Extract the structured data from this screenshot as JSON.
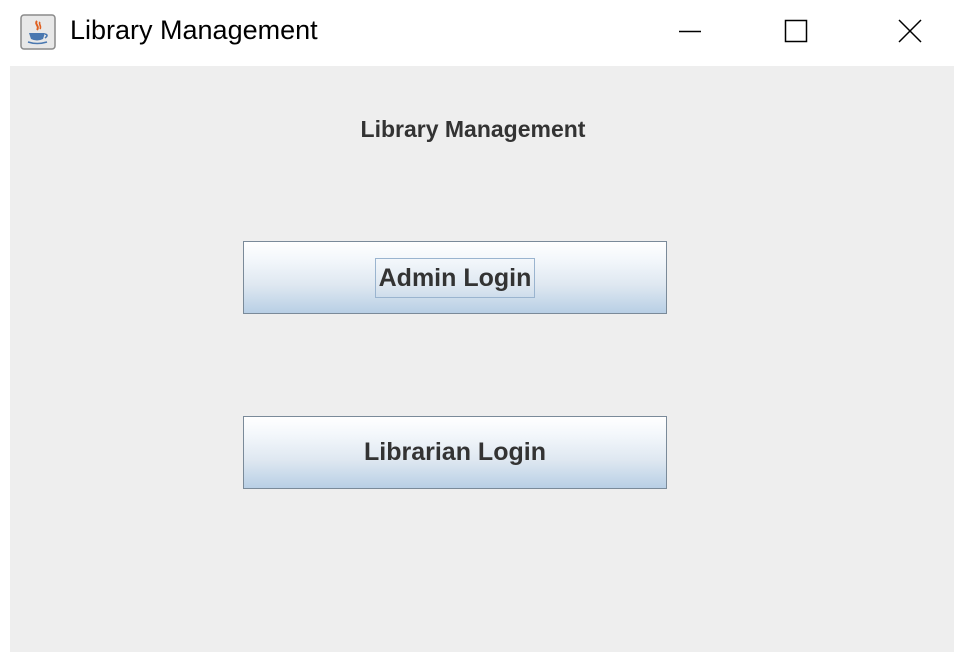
{
  "window": {
    "title": "Library Management",
    "app_icon": "java-coffee-cup-icon",
    "controls": {
      "minimize_icon": "minimize-icon",
      "maximize_icon": "maximize-icon",
      "close_icon": "close-icon"
    }
  },
  "main": {
    "heading": "Library Management",
    "admin_login_label": "Admin Login",
    "librarian_login_label": "Librarian Login",
    "focused_button": "admin_login"
  },
  "colors": {
    "panel_background": "#eeeeee",
    "text": "#333333",
    "button_border": "#7a8a99",
    "button_gradient_bottom": "#b8cfe5"
  }
}
